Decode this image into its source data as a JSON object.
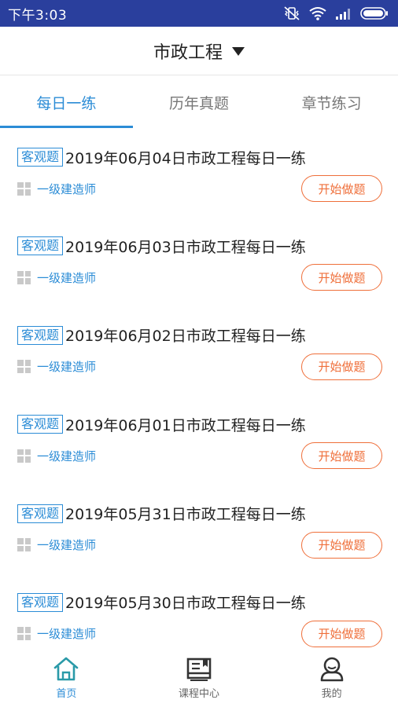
{
  "status_bar": {
    "time": "下午3:03",
    "icons": [
      "vibrate-icon",
      "wifi-icon",
      "signal-icon",
      "battery-icon"
    ]
  },
  "header": {
    "title": "市政工程",
    "dropdown_icon": "caret-down-icon"
  },
  "tabs": [
    {
      "label": "每日一练",
      "active": true
    },
    {
      "label": "历年真题",
      "active": false
    },
    {
      "label": "章节练习",
      "active": false
    }
  ],
  "items": [
    {
      "tag": "客观题",
      "title": "2019年06月04日市政工程每日一练",
      "category": "一级建造师",
      "button": "开始做题"
    },
    {
      "tag": "客观题",
      "title": "2019年06月03日市政工程每日一练",
      "category": "一级建造师",
      "button": "开始做题"
    },
    {
      "tag": "客观题",
      "title": "2019年06月02日市政工程每日一练",
      "category": "一级建造师",
      "button": "开始做题"
    },
    {
      "tag": "客观题",
      "title": "2019年06月01日市政工程每日一练",
      "category": "一级建造师",
      "button": "开始做题"
    },
    {
      "tag": "客观题",
      "title": "2019年05月31日市政工程每日一练",
      "category": "一级建造师",
      "button": "开始做题"
    },
    {
      "tag": "客观题",
      "title": "2019年05月30日市政工程每日一练",
      "category": "一级建造师",
      "button": "开始做题"
    }
  ],
  "bottom_nav": [
    {
      "label": "首页",
      "icon": "home-icon",
      "active": true
    },
    {
      "label": "课程中心",
      "icon": "book-icon",
      "active": false
    },
    {
      "label": "我的",
      "icon": "user-icon",
      "active": false
    }
  ],
  "colors": {
    "status_bar": "#2a3f9d",
    "accent": "#2b8cd6",
    "button": "#ef6f3a"
  }
}
